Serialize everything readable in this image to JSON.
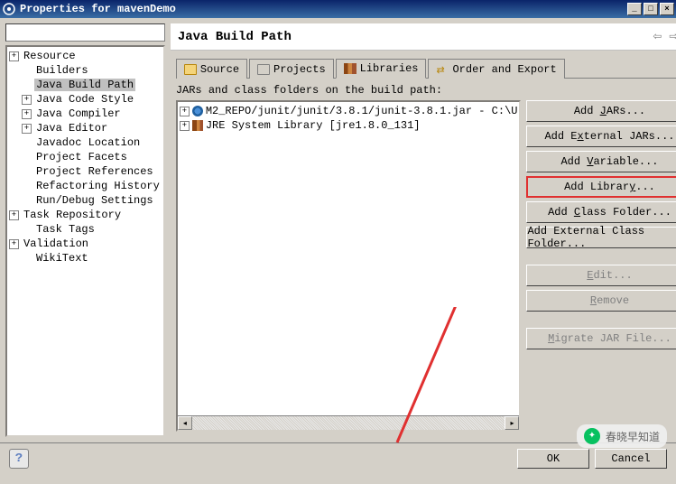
{
  "window": {
    "title": "Properties for mavenDemo"
  },
  "tree": {
    "items": [
      {
        "label": "Resource",
        "expandable": true,
        "indent": 0
      },
      {
        "label": "Builders",
        "expandable": false,
        "indent": 1
      },
      {
        "label": "Java Build Path",
        "expandable": false,
        "indent": 1,
        "selected": true
      },
      {
        "label": "Java Code Style",
        "expandable": true,
        "indent": 1
      },
      {
        "label": "Java Compiler",
        "expandable": true,
        "indent": 1
      },
      {
        "label": "Java Editor",
        "expandable": true,
        "indent": 1
      },
      {
        "label": "Javadoc Location",
        "expandable": false,
        "indent": 1
      },
      {
        "label": "Project Facets",
        "expandable": false,
        "indent": 1
      },
      {
        "label": "Project References",
        "expandable": false,
        "indent": 1
      },
      {
        "label": "Refactoring History",
        "expandable": false,
        "indent": 1
      },
      {
        "label": "Run/Debug Settings",
        "expandable": false,
        "indent": 1
      },
      {
        "label": "Task Repository",
        "expandable": true,
        "indent": 0
      },
      {
        "label": "Task Tags",
        "expandable": false,
        "indent": 1
      },
      {
        "label": "Validation",
        "expandable": true,
        "indent": 0
      },
      {
        "label": "WikiText",
        "expandable": false,
        "indent": 1
      }
    ]
  },
  "page": {
    "title": "Java Build Path",
    "tabs": {
      "source": "Source",
      "projects": "Projects",
      "libraries": "Libraries",
      "order": "Order and Export"
    },
    "subtitle": "JARs and class folders on the build path:",
    "list": {
      "item1": "M2_REPO/junit/junit/3.8.1/junit-3.8.1.jar - C:\\U",
      "item2": "JRE System Library [jre1.8.0_131]"
    },
    "buttons": {
      "add_jars": "Add JARs...",
      "add_ext_jars": "Add External JARs...",
      "add_variable": "Add Variable...",
      "add_library": "Add Library...",
      "add_class_folder": "Add Class Folder...",
      "add_ext_class_folder": "Add External Class Folder...",
      "edit": "Edit...",
      "remove": "Remove",
      "migrate": "Migrate JAR File..."
    }
  },
  "bottom": {
    "ok": "OK",
    "cancel": "Cancel"
  },
  "watermark": {
    "text": "春晓早知道"
  }
}
